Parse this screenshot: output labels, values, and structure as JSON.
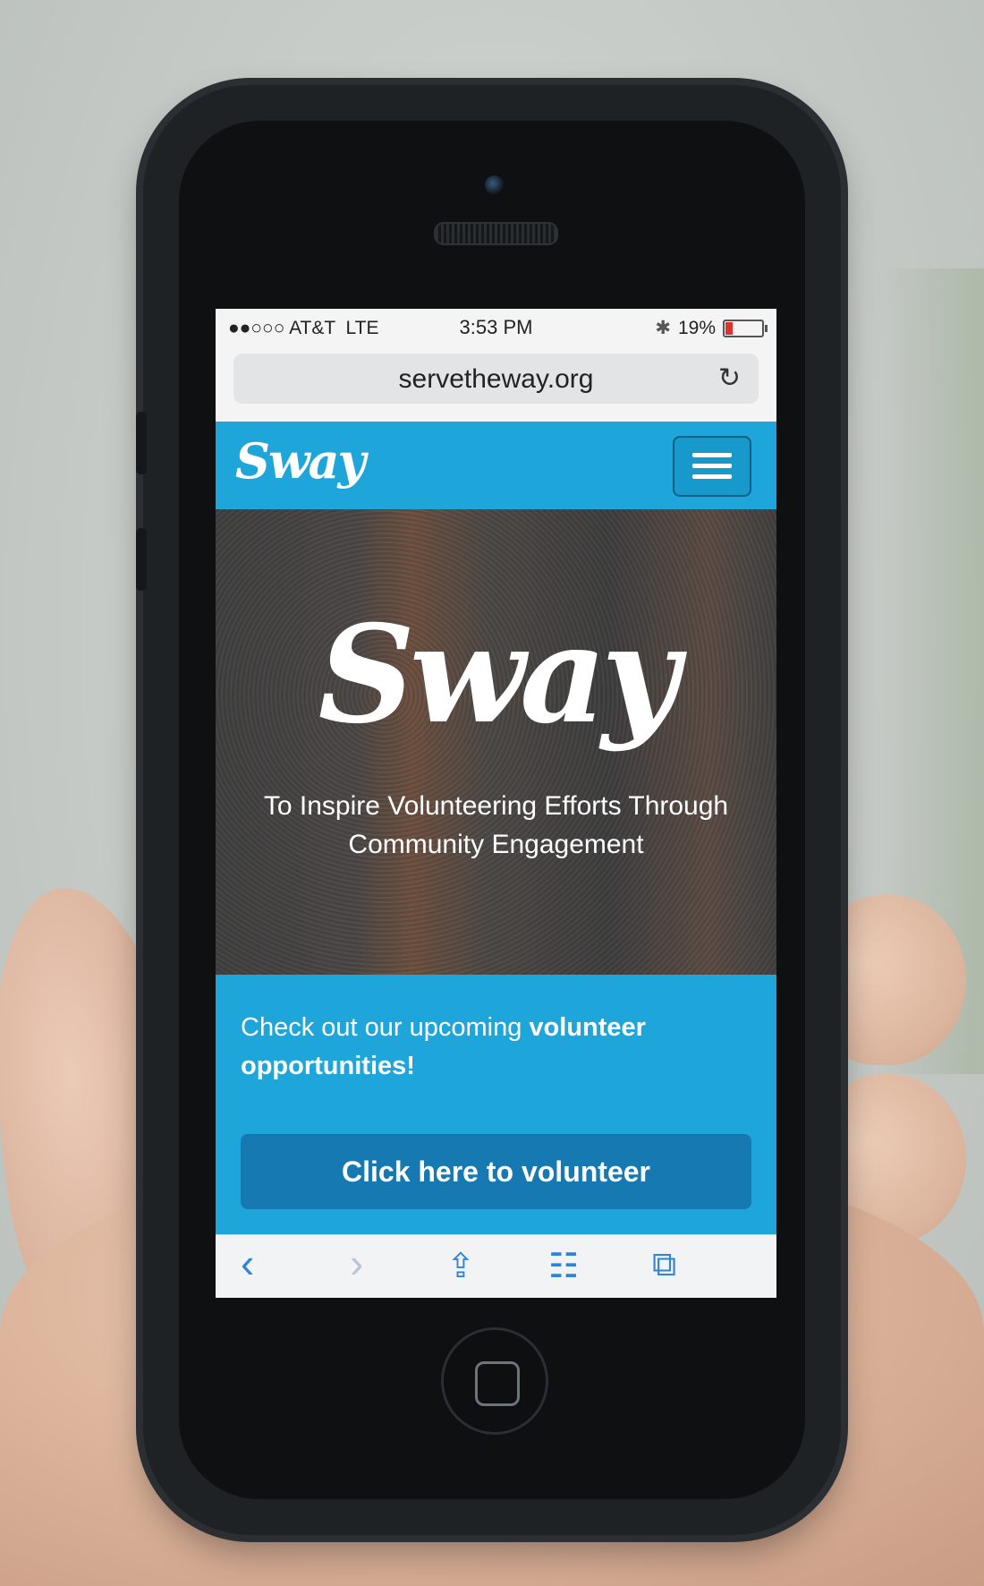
{
  "status_bar": {
    "carrier": "●●○○○ AT&T",
    "network": "LTE",
    "time": "3:53 PM",
    "bluetooth_icon": "bluetooth-icon",
    "battery": "19%",
    "battery_level": 0.19
  },
  "browser": {
    "url": "servetheway.org",
    "reload_icon": "reload-icon"
  },
  "site": {
    "logo_small": "Sway",
    "menu_icon": "hamburger-menu-icon",
    "logo_big": "Sway",
    "tagline": "To Inspire Volunteering Efforts Through Community Engagement",
    "cta_text_plain": "Check out our upcoming ",
    "cta_text_bold": "volunteer opportunities!",
    "cta_button": "Click here to volunteer"
  },
  "toolbar": {
    "back": "‹",
    "forward": "›",
    "share": "⇪",
    "bookmarks": "📖",
    "tabs": "⧉"
  },
  "colors": {
    "brand_blue": "#1ea6db",
    "button_blue": "#1679b1",
    "battery_red": "#e0312c"
  }
}
